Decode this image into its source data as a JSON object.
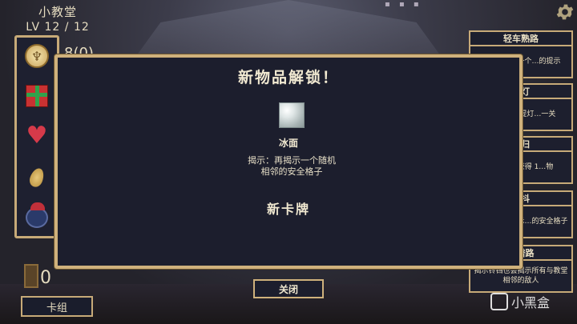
{
  "level": {
    "title": "小教堂",
    "text": "LV 12 / 12"
  },
  "items_panel": {
    "counter": "8(0)",
    "icons": [
      "coin-icon",
      "gift-icon",
      "heart-icon",
      "seed-icon",
      "creature-icon"
    ]
  },
  "bottom_left": {
    "door_count": "0",
    "deck_label": "卡组"
  },
  "tips": [
    {
      "title": "轻车熟路",
      "body": "…始时揭示一个…的提示"
    },
    {
      "title": "…灯",
      "body": "…携带1个提灯…一关"
    },
    {
      "title": "…归",
      "body": "…格子，获得 1…物"
    },
    {
      "title": "…抖",
      "body": "…格子也会揭示…的安全格子"
    },
    {
      "title": "…谱路",
      "body": "揭示铃铛也会揭示所有与教堂相邻的敌人"
    }
  ],
  "modal": {
    "title": "新物品解锁！",
    "item_name": "冰面",
    "item_desc": "揭示：再揭示一个随机相邻的安全格子",
    "subtitle": "新卡牌",
    "close_label": "关闭"
  },
  "watermark": "小黑盒",
  "colors": {
    "border_gold": "#cfb17c",
    "panel_bg": "#1c1e2d"
  }
}
